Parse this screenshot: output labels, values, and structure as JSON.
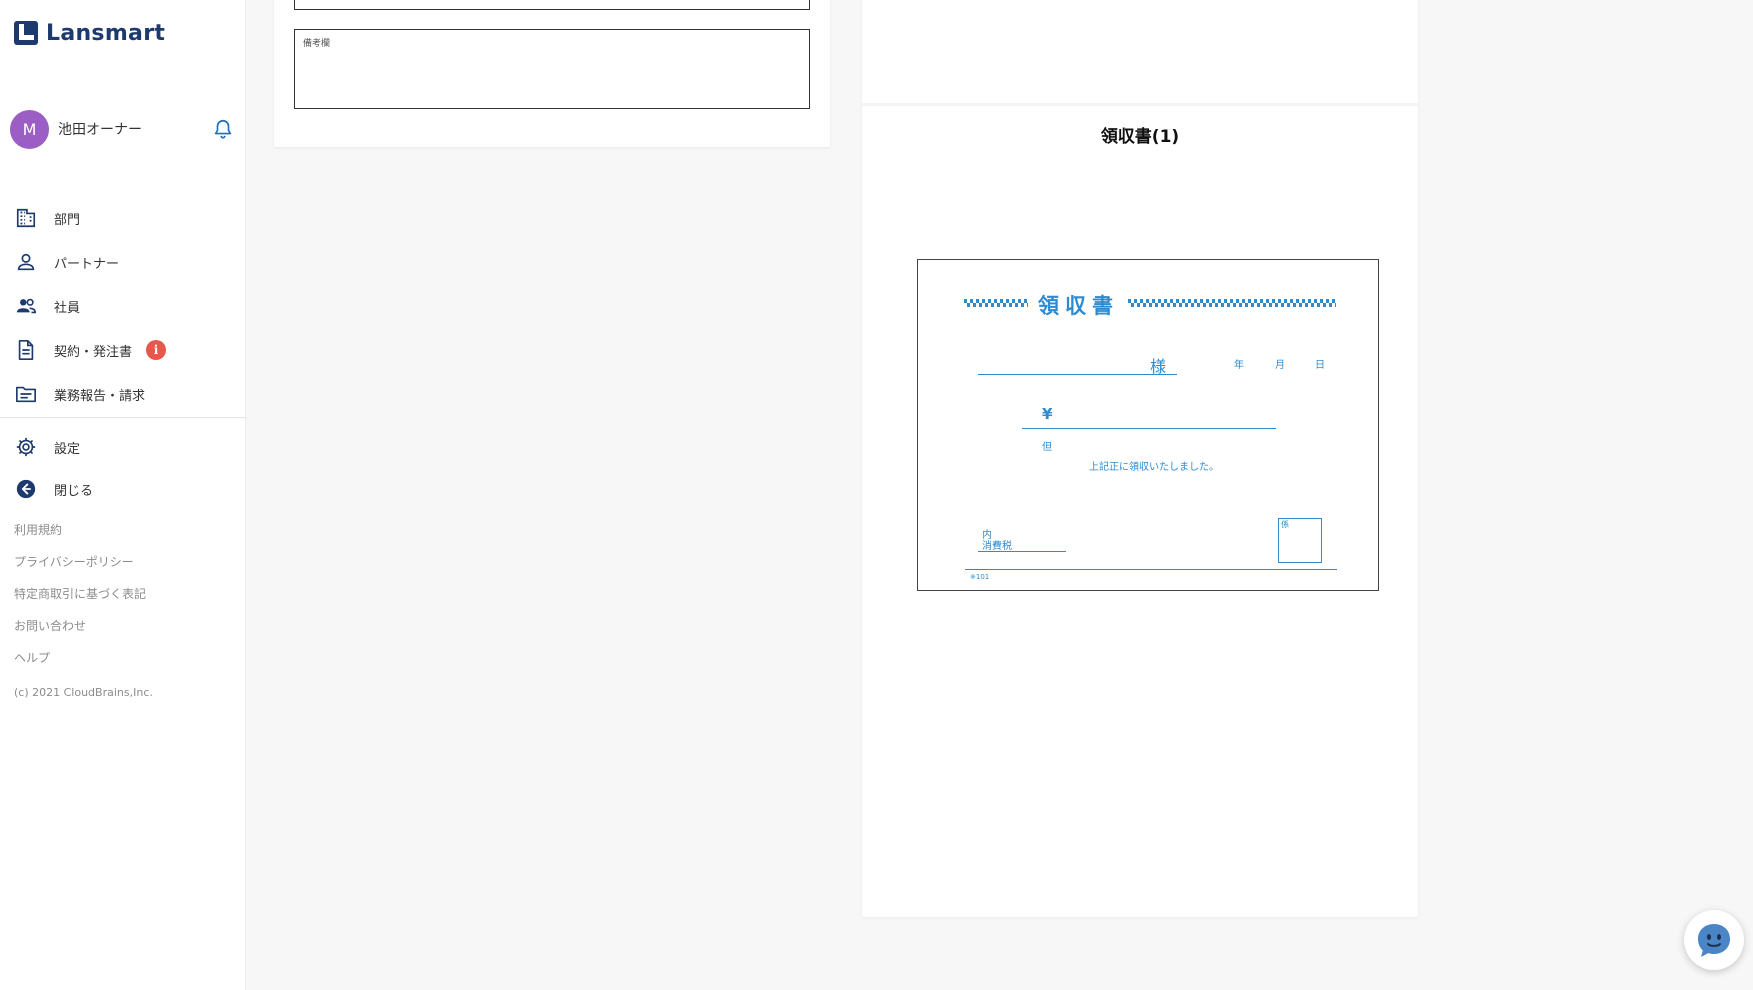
{
  "app": {
    "brand": "Lansmart",
    "brand_color": "#1d3a6e"
  },
  "user": {
    "avatar_initial": "M",
    "avatar_color": "#9b5ec4",
    "name": "池田オーナー"
  },
  "nav": {
    "items": [
      {
        "label": "部門",
        "icon": "building-icon"
      },
      {
        "label": "パートナー",
        "icon": "person-icon"
      },
      {
        "label": "社員",
        "icon": "people-icon"
      },
      {
        "label": "契約・発注書",
        "icon": "document-icon",
        "badge": "i",
        "badge_color": "#e8574b"
      },
      {
        "label": "業務報告・請求",
        "icon": "folder-icon"
      }
    ],
    "secondary": [
      {
        "label": "設定",
        "icon": "gear-icon"
      },
      {
        "label": "閉じる",
        "icon": "arrow-left-circle-icon"
      }
    ]
  },
  "footer_links": [
    "利用規約",
    "プライバシーポリシー",
    "特定商取引に基づく表記",
    "お問い合わせ",
    "ヘルプ"
  ],
  "copyright": "(c) 2021 CloudBrains,Inc.",
  "form": {
    "remarks_label": "備考欄"
  },
  "preview": {
    "title": "領収書(1)",
    "receipt": {
      "heading": "領収書",
      "sama": "様",
      "year": "年",
      "month": "月",
      "day": "日",
      "yen": "¥",
      "tadashi": "但",
      "received_text": "上記正に領収いたしました。",
      "uchi": "内",
      "tax": "消費税",
      "kakari": "係",
      "code": "※101",
      "ink_color": "#2e8bd0"
    }
  },
  "chatbot": {
    "icon": "chatbot-icon",
    "color": "#4a86c5"
  }
}
